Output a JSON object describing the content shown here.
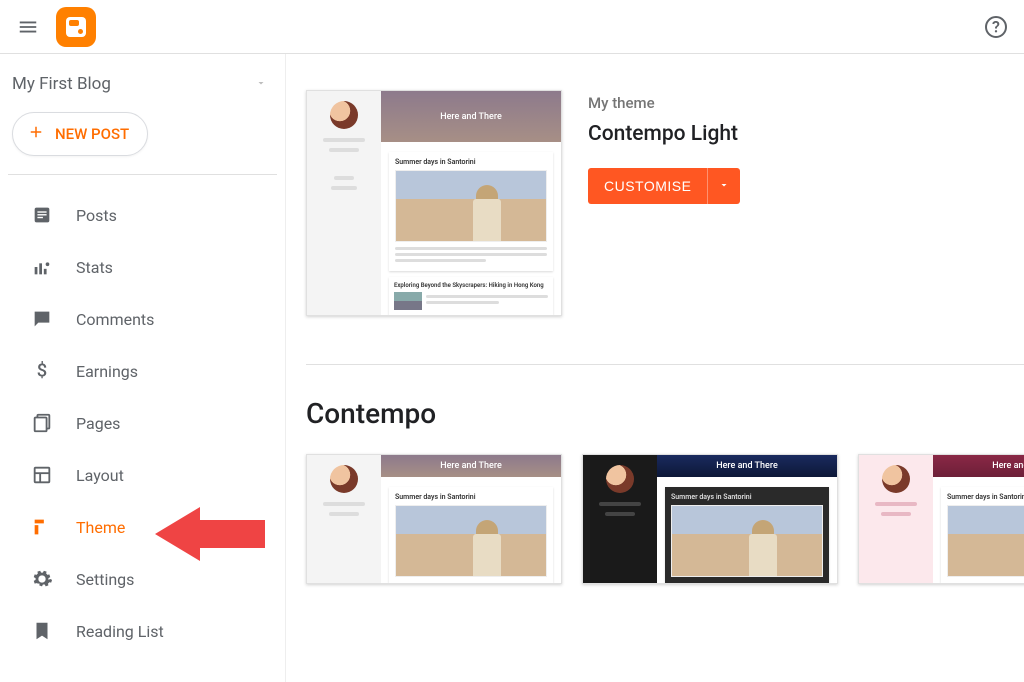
{
  "header": {
    "blog_name": "My First Blog"
  },
  "sidebar": {
    "new_post_label": "NEW POST",
    "items": [
      {
        "label": "Posts",
        "icon": "posts"
      },
      {
        "label": "Stats",
        "icon": "stats"
      },
      {
        "label": "Comments",
        "icon": "comments"
      },
      {
        "label": "Earnings",
        "icon": "earnings"
      },
      {
        "label": "Pages",
        "icon": "pages"
      },
      {
        "label": "Layout",
        "icon": "layout"
      },
      {
        "label": "Theme",
        "icon": "theme"
      },
      {
        "label": "Settings",
        "icon": "settings"
      },
      {
        "label": "Reading List",
        "icon": "reading"
      }
    ]
  },
  "main": {
    "my_theme_label": "My theme",
    "my_theme_name": "Contempo Light",
    "customise_label": "CUSTOMISE",
    "preview": {
      "hero_title": "Here and There",
      "post1_title": "Summer days in Santorini",
      "post2_title": "Exploring Beyond the Skyscrapers: Hiking in Hong Kong"
    },
    "section_title": "Contempo",
    "themes": [
      {
        "variant": "light",
        "hero": "Here and There",
        "post": "Summer days in Santorini"
      },
      {
        "variant": "dark",
        "hero": "Here and There",
        "post": "Summer days in Santorini"
      },
      {
        "variant": "pink",
        "hero": "Here and There",
        "post": "Summer days in Santorini"
      }
    ]
  }
}
